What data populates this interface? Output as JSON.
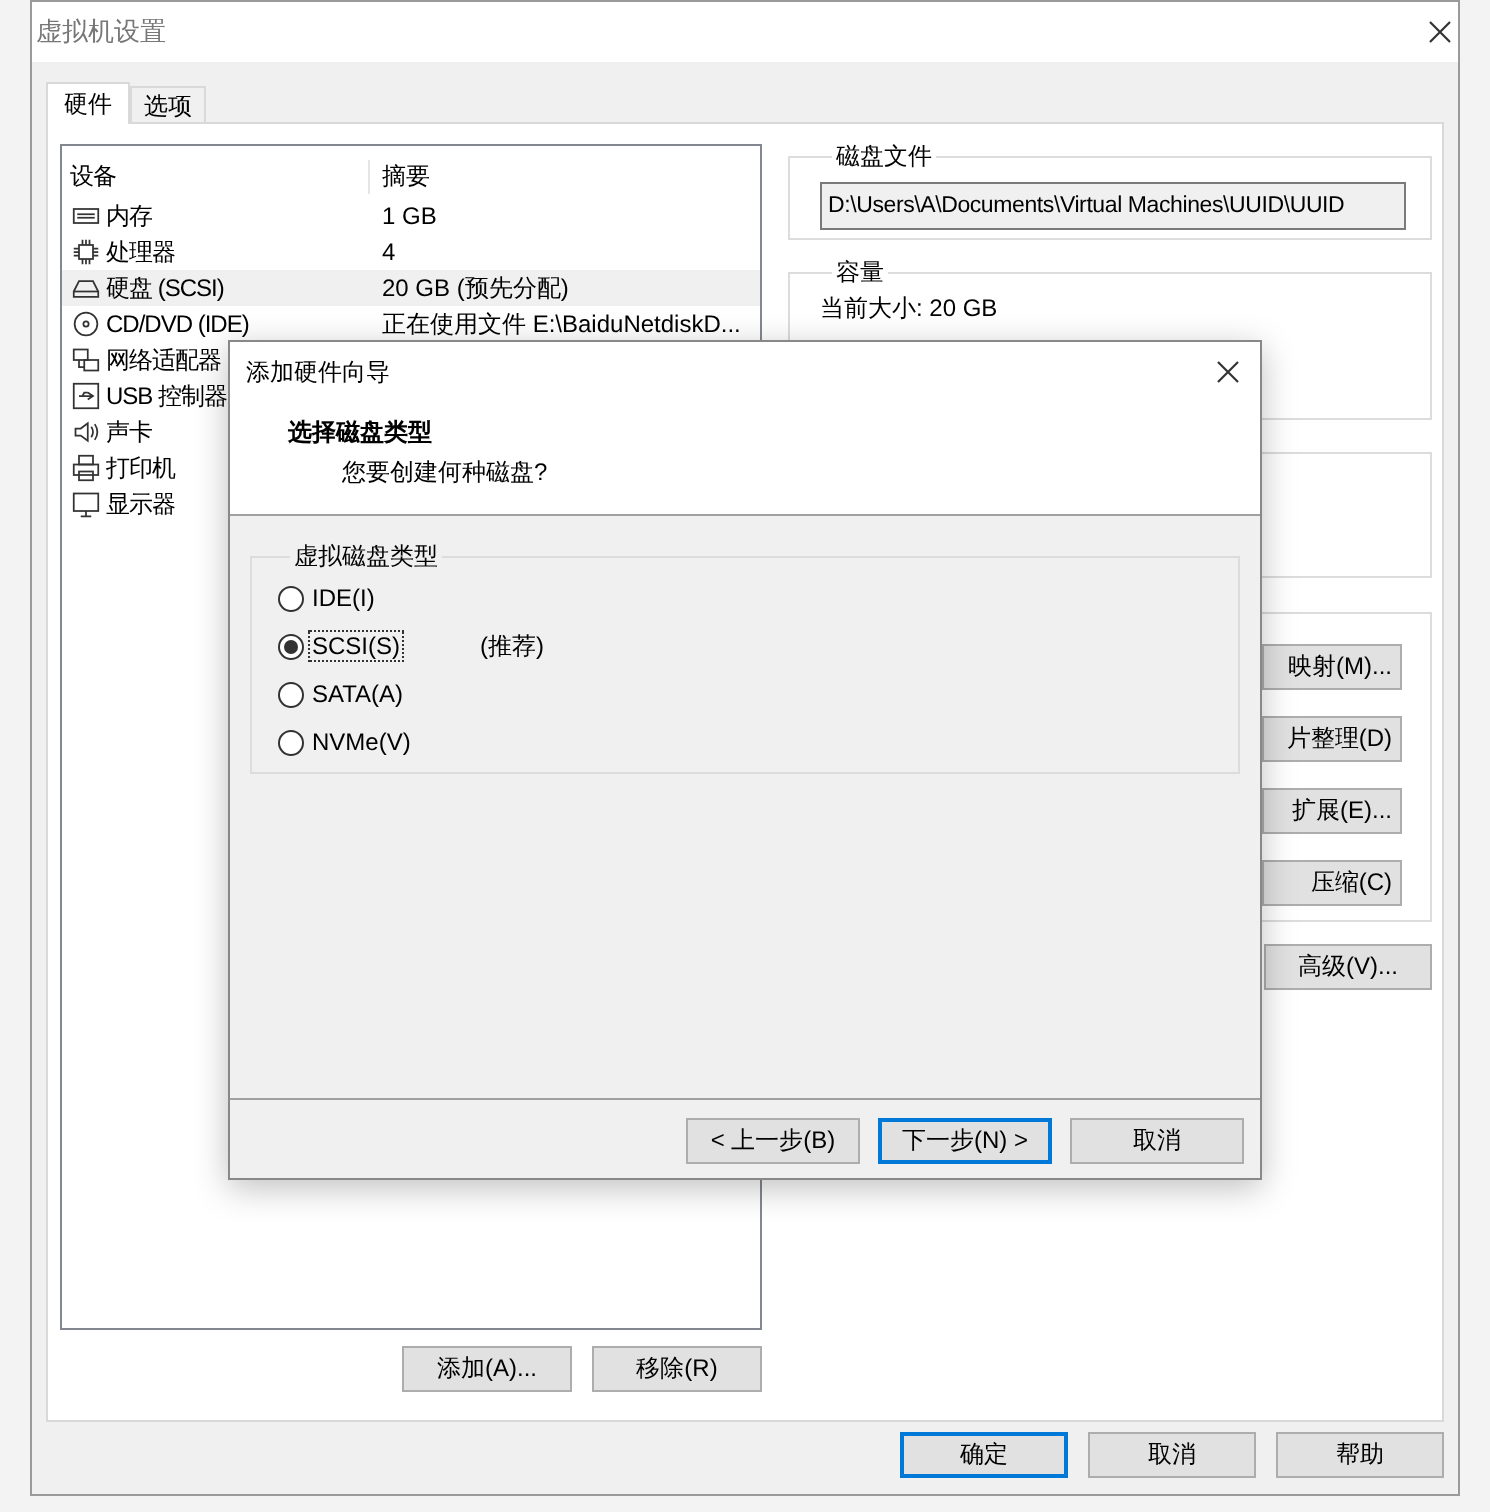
{
  "window": {
    "title": "虚拟机设置"
  },
  "tabs": [
    {
      "label": "硬件",
      "selected": true
    },
    {
      "label": "选项",
      "selected": false
    }
  ],
  "device_list": {
    "columns": [
      "设备",
      "摘要"
    ],
    "rows": [
      {
        "kind": "memory",
        "name": "内存",
        "summary": "1 GB",
        "selected": false
      },
      {
        "kind": "cpu",
        "name": "处理器",
        "summary": "4",
        "selected": false
      },
      {
        "kind": "disk",
        "name": "硬盘 (SCSI)",
        "summary": "20 GB (预先分配)",
        "selected": true
      },
      {
        "kind": "cd",
        "name": "CD/DVD (IDE)",
        "summary": "正在使用文件 E:\\BaiduNetdiskD...",
        "selected": false
      },
      {
        "kind": "network",
        "name": "网络适配器",
        "selected": false
      },
      {
        "kind": "usb",
        "name": "USB 控制器",
        "selected": false
      },
      {
        "kind": "sound",
        "name": "声卡",
        "selected": false
      },
      {
        "kind": "printer",
        "name": "打印机",
        "selected": false
      },
      {
        "kind": "monitor",
        "name": "显示器",
        "selected": false
      }
    ]
  },
  "list_buttons": [
    "添加(A)...",
    "移除(R)"
  ],
  "disk_file": {
    "title": "磁盘文件",
    "value": "D:\\Users\\A\\Documents\\Virtual Machines\\UUID\\UUID"
  },
  "capacity": {
    "title": "容量",
    "current_size": "当前大小: 20 GB"
  },
  "utility_buttons": [
    "映射(M)...",
    "片整理(D)",
    "扩展(E)...",
    "压缩(C)"
  ],
  "advanced_button": "高级(V)...",
  "footer_buttons": [
    {
      "label": "确定",
      "default": true
    },
    {
      "label": "取消",
      "default": false
    },
    {
      "label": "帮助",
      "default": false
    }
  ],
  "wizard": {
    "title": "添加硬件向导",
    "heading": "选择磁盘类型",
    "subheading": "您要创建何种磁盘?",
    "group_title": "虚拟磁盘类型",
    "options": [
      {
        "label": "IDE(I)",
        "selected": false
      },
      {
        "label": "SCSI(S)",
        "selected": true,
        "note": "(推荐)"
      },
      {
        "label": "SATA(A)",
        "selected": false
      },
      {
        "label": "NVMe(V)",
        "selected": false
      }
    ],
    "buttons": [
      {
        "label": "< 上一步(B)",
        "default": false
      },
      {
        "label": "下一步(N) >",
        "default": true
      },
      {
        "label": "取消",
        "default": false
      }
    ]
  }
}
